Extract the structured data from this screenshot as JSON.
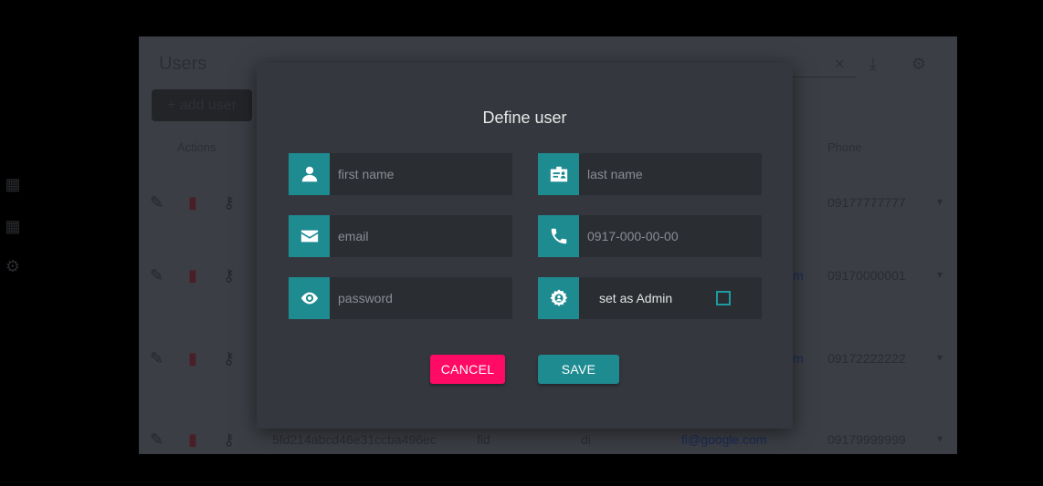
{
  "background_app": {
    "title": "Users",
    "add_button_label": "+ add user",
    "columns": {
      "actions": "Actions",
      "phone": "Phone"
    },
    "rows": [
      {
        "id": "",
        "first": "",
        "last": "",
        "email": "",
        "phone": "09177777777"
      },
      {
        "id": "",
        "first": "",
        "last": "",
        "email": "m",
        "phone": "09170000001"
      },
      {
        "id": "",
        "first": "",
        "last": "",
        "email": "m",
        "phone": "09172222222"
      },
      {
        "id": "5fd214abcd46e31ccba496ec",
        "first": "fid",
        "last": "di",
        "email": "fi@google.com",
        "phone": "09179999999"
      }
    ],
    "toolbar": {
      "clear_icon": "×",
      "download_icon": "download-icon",
      "settings_icon": "gear-icon"
    }
  },
  "modal": {
    "title": "Define user",
    "fields": {
      "first_name": {
        "placeholder": "first name",
        "icon": "user-icon"
      },
      "last_name": {
        "placeholder": "last name",
        "icon": "id-card-icon"
      },
      "email": {
        "placeholder": "email",
        "icon": "envelope-icon"
      },
      "phone": {
        "placeholder": "0917-000-00-00",
        "icon": "phone-icon"
      },
      "password": {
        "placeholder": "password",
        "icon": "eye-icon"
      },
      "admin": {
        "label": "set as Admin",
        "checked": false,
        "icon": "user-gear-icon"
      }
    },
    "buttons": {
      "cancel": "CANCEL",
      "save": "SAVE"
    }
  },
  "colors": {
    "accent": "#1e8b91",
    "cancel": "#ff0a64",
    "modal_bg": "#34373d",
    "field_bg": "#2a2d32"
  }
}
